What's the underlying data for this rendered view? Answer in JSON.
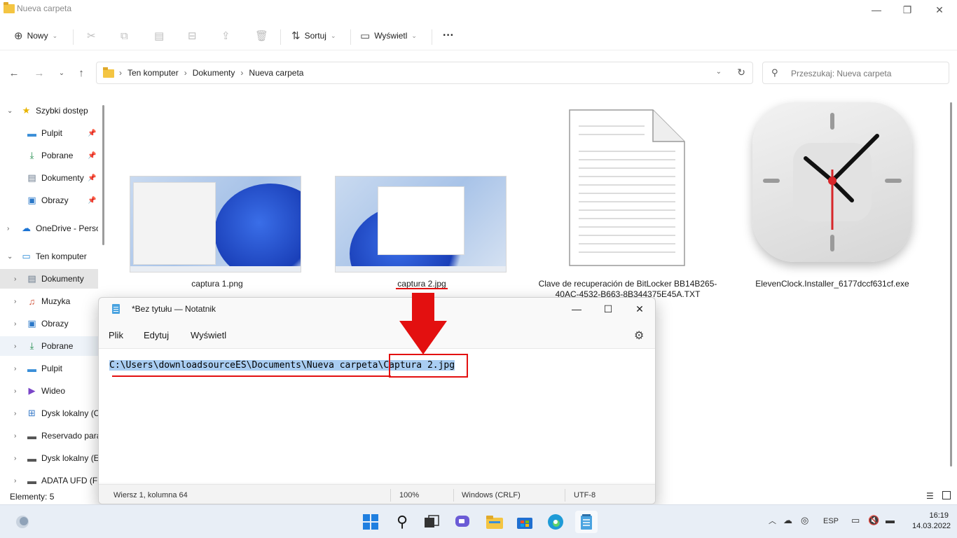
{
  "explorer": {
    "title": "Nueva carpeta",
    "toolbar": {
      "new_label": "Nowy",
      "sort_label": "Sortuj",
      "view_label": "Wyświetl",
      "more_label": "···"
    },
    "breadcrumb": [
      "Ten komputer",
      "Dokumenty",
      "Nueva carpeta"
    ],
    "search_placeholder": "Przeszukaj: Nueva carpeta",
    "sidebar": [
      {
        "label": "Szybki dostęp",
        "icon": "star-icon"
      },
      {
        "label": "Pulpit",
        "icon": "desktop-icon"
      },
      {
        "label": "Pobrane",
        "icon": "download-icon"
      },
      {
        "label": "Dokumenty",
        "icon": "document-icon"
      },
      {
        "label": "Obrazy",
        "icon": "pictures-icon"
      },
      {
        "label": "OneDrive - Perso",
        "icon": "cloud-icon"
      },
      {
        "label": "Ten komputer",
        "icon": "computer-icon"
      },
      {
        "label": "Dokumenty",
        "icon": "document-icon"
      },
      {
        "label": "Muzyka",
        "icon": "music-icon"
      },
      {
        "label": "Obrazy",
        "icon": "pictures-icon"
      },
      {
        "label": "Pobrane",
        "icon": "download-icon"
      },
      {
        "label": "Pulpit",
        "icon": "desktop-icon"
      },
      {
        "label": "Wideo",
        "icon": "video-icon"
      },
      {
        "label": "Dysk lokalny (C",
        "icon": "drive-icon"
      },
      {
        "label": "Reservado para",
        "icon": "drive-icon"
      },
      {
        "label": "Dysk lokalny (E",
        "icon": "drive-icon"
      },
      {
        "label": "ADATA UFD (F:)",
        "icon": "usb-drive-icon"
      }
    ],
    "files": [
      {
        "name": "captura 1.png"
      },
      {
        "name": "captura 2.jpg"
      },
      {
        "name": "Clave de recuperación de BitLocker BB14B265-40AC-4532-B663-8B344375E45A.TXT"
      },
      {
        "name": "ElevenClock.Installer_6177dccf631cf.exe"
      }
    ],
    "status": "Elementy: 5"
  },
  "notepad": {
    "title": "*Bez tytułu — Notatnik",
    "menu": [
      "Plik",
      "Edytuj",
      "Wyświetl"
    ],
    "path_prefix": "C:\\Users\\downloadsourceES\\Documents\\Nueva carpeta\\",
    "path_file": "Captura 2.jpg",
    "status": {
      "position": "Wiersz 1, kolumna 64",
      "zoom": "100%",
      "line_endings": "Windows (CRLF)",
      "encoding": "UTF-8"
    }
  },
  "taskbar": {
    "language": "ESP",
    "time": "16:19",
    "date": "14.03.2022"
  },
  "colors": {
    "annotation_red": "#e31010",
    "selection_blue": "#a9cdf2",
    "folder_yellow": "#f4c542"
  }
}
